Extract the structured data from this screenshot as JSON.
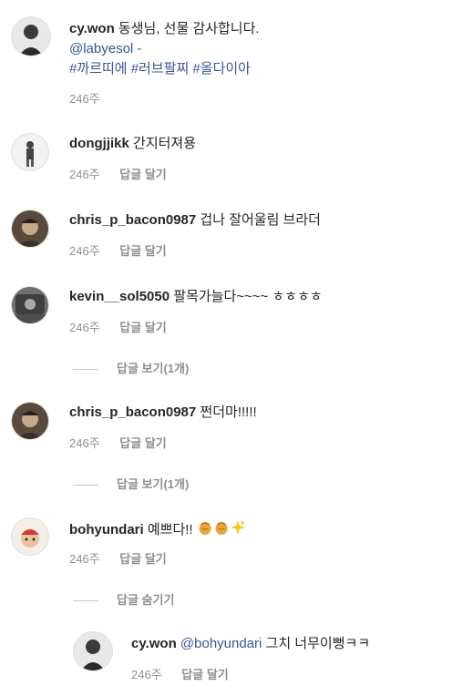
{
  "comments": [
    {
      "username": "cy.won",
      "text": "동생님, 선물 감사합니다.",
      "mention": "@labyesol",
      "mention_suffix": " -",
      "hashtags": "#까르띠에 #러브팔찌 #올다이아",
      "time": "246주"
    },
    {
      "username": "dongjjikk",
      "text": "간지터져용",
      "time": "246주",
      "reply": "답글 달기"
    },
    {
      "username": "chris_p_bacon0987",
      "text": "겁나 잘어울림 브라더",
      "time": "246주",
      "reply": "답글 달기"
    },
    {
      "username": "kevin__sol5050",
      "text": "팔목가늘다~~~~ ㅎㅎㅎㅎ",
      "time": "246주",
      "reply": "답글 달기",
      "thread": "답글 보기(1개)"
    },
    {
      "username": "chris_p_bacon0987",
      "text": "쩐더마!!!!!",
      "time": "246주",
      "reply": "답글 달기",
      "thread": "답글 보기(1개)"
    },
    {
      "username": "bohyundari",
      "text": "예쁘다!!",
      "emojis": [
        "clap-hands-icon",
        "clap-hands-icon",
        "sparkles-icon"
      ],
      "time": "246주",
      "reply": "답글 달기",
      "thread": "답글 숨기기"
    }
  ],
  "nested_reply": {
    "username": "cy.won",
    "mention": "@bohyundari",
    "text": " 그치 너무이뻥ㅋㅋ",
    "time": "246주",
    "reply": "답글 달기"
  }
}
